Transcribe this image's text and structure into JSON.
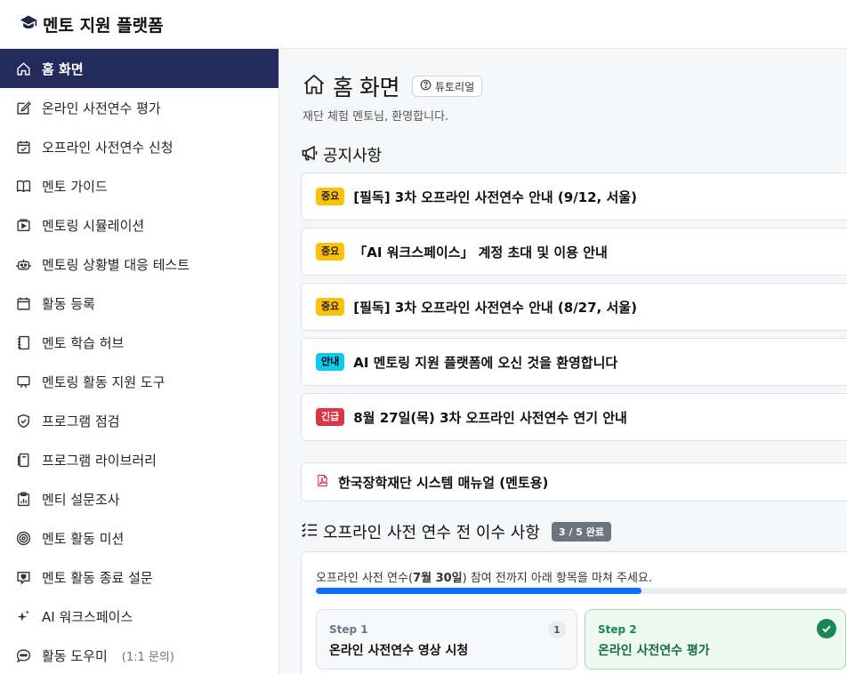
{
  "app": {
    "title": "멘토 지원 플랫폼"
  },
  "sidebar": {
    "items": [
      {
        "label": "홈 화면",
        "icon": "home-icon"
      },
      {
        "label": "온라인 사전연수 평가",
        "icon": "edit-icon"
      },
      {
        "label": "오프라인 사전연수 신청",
        "icon": "calendar-check-icon"
      },
      {
        "label": "멘토 가이드",
        "icon": "book-icon"
      },
      {
        "label": "멘토링 시뮬레이션",
        "icon": "video-play-icon"
      },
      {
        "label": "멘토링 상황별 대응 테스트",
        "icon": "robot-icon"
      },
      {
        "label": "활동 등록",
        "icon": "calendar-icon"
      },
      {
        "label": "멘토 학습 허브",
        "icon": "journal-icon"
      },
      {
        "label": "멘토링 활동 지원 도구",
        "icon": "easel-icon"
      },
      {
        "label": "프로그램 점검",
        "icon": "shield-check-icon"
      },
      {
        "label": "프로그램 라이브러리",
        "icon": "library-icon"
      },
      {
        "label": "멘티 설문조사",
        "icon": "clipboard-data-icon"
      },
      {
        "label": "멘토 활동 미션",
        "icon": "target-icon"
      },
      {
        "label": "멘토 활동 종료 설문",
        "icon": "chat-heart-icon"
      },
      {
        "label": "AI 워크스페이스",
        "icon": "sparkle-icon"
      },
      {
        "label": "활동 도우미",
        "sub": "(1:1 문의)",
        "icon": "chat-dots-icon"
      }
    ]
  },
  "header": {
    "title": "홈 화면",
    "tutorial_label": "튜토리얼",
    "welcome": "재단 체험 멘토님, 환영합니다."
  },
  "notices": {
    "title": "공지사항",
    "items": [
      {
        "badge": "중요",
        "text": "[필독] 3차 오프라인 사전연수 안내 (9/12, 서울)"
      },
      {
        "badge": "중요",
        "text": "「AI 워크스페이스」 계정 초대 및 이용 안내"
      },
      {
        "badge": "중요",
        "text": "[필독] 3차 오프라인 사전연수 안내 (8/27, 서울)"
      },
      {
        "badge": "안내",
        "text": "AI 멘토링 지원 플랫폼에 오신 것을 환영합니다"
      },
      {
        "badge": "긴급",
        "text": "8월 27일(목) 3차 오프라인 사전연수 연기 안내"
      }
    ]
  },
  "manual": {
    "label": "한국장학재단 시스템 매뉴얼 (멘토용)"
  },
  "checklist": {
    "title": "오프라인 사전 연수 전 이수 사항",
    "count": "3 / 5 완료",
    "progress": 0.6,
    "desc_prefix": "오프라인 사전 연수(",
    "desc_date": "7월 30일",
    "desc_suffix": ") 참여 전까지 아래 항목을 마쳐 주세요.",
    "steps": [
      {
        "label": "Step 1",
        "name": "온라인 사전연수 영상 시청",
        "num": "1",
        "done": false
      },
      {
        "label": "Step 2",
        "name": "온라인 사전연수 평가",
        "done": true
      }
    ]
  },
  "colors": {
    "sidebar_active": "#232a5c",
    "badge_important": "#ffc107",
    "badge_info": "#0dcaf0",
    "badge_urgent": "#dc3545",
    "progress": "#0d6efd",
    "success": "#198754"
  }
}
